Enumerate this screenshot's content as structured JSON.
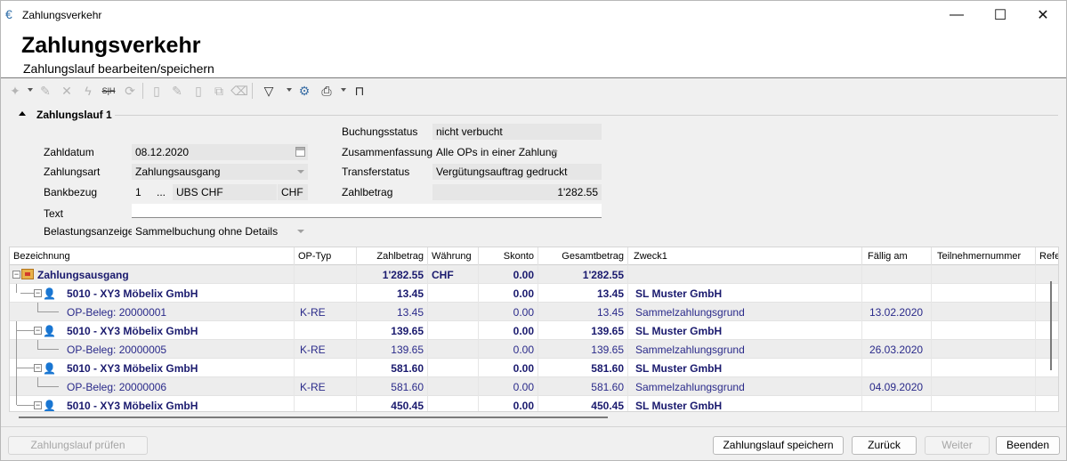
{
  "window": {
    "title": "Zahlungsverkehr",
    "minimize": "—",
    "maximize": "☐",
    "close": "✕"
  },
  "header": {
    "title": "Zahlungsverkehr",
    "subtitle": "Zahlungslauf bearbeiten/speichern"
  },
  "toolbar": {
    "icons": [
      "wand-icon",
      "pencil-icon",
      "delete-icon",
      "lightning-icon",
      "s-h-icon",
      "refresh-icon",
      "new-document-icon",
      "edit-document-icon",
      "delete-document-icon",
      "copy-document-icon",
      "eraser-icon",
      "filter-icon",
      "settings-icon",
      "print-icon",
      "export-icon"
    ]
  },
  "group": {
    "title": "Zahlungslauf 1"
  },
  "form": {
    "zahldatum": {
      "label": "Zahldatum",
      "value": "08.12.2020"
    },
    "zahlungsart": {
      "label": "Zahlungsart",
      "value": "Zahlungsausgang"
    },
    "bankbezug": {
      "label": "Bankbezug",
      "number": "1",
      "ellipsis": "...",
      "bank": "UBS CHF",
      "currency": "CHF"
    },
    "text": {
      "label": "Text",
      "value": ""
    },
    "belastungsanzeige": {
      "label": "Belastungsanzeige",
      "value": "Sammelbuchung ohne Details"
    },
    "buchungsstatus": {
      "label": "Buchungsstatus",
      "value": "nicht verbucht"
    },
    "zusammenfassung": {
      "label": "Zusammenfassung",
      "value": "Alle OPs in einer Zahlung"
    },
    "transferstatus": {
      "label": "Transferstatus",
      "value": "Vergütungsauftrag gedruckt"
    },
    "zahlbetrag": {
      "label": "Zahlbetrag",
      "value": "1'282.55"
    }
  },
  "grid": {
    "columns": [
      "Bezeichnung",
      "OP-Typ",
      "Zahlbetrag",
      "Währung",
      "Skonto",
      "Gesamtbetrag",
      "Zweck1",
      "Fällig am",
      "Teilnehmernummer",
      "Refe"
    ],
    "rows": [
      {
        "kind": "root",
        "bezeichnung": "Zahlungsausgang",
        "optyp": "",
        "zahlbetrag": "1'282.55",
        "waehrung": "CHF",
        "skonto": "0.00",
        "gesamt": "1'282.55",
        "zweck": "",
        "faellig": ""
      },
      {
        "kind": "group",
        "bezeichnung": "5010 - XY3 Möbelix GmbH",
        "optyp": "",
        "zahlbetrag": "13.45",
        "waehrung": "",
        "skonto": "0.00",
        "gesamt": "13.45",
        "zweck": "SL Muster GmbH",
        "faellig": ""
      },
      {
        "kind": "item",
        "bezeichnung": "OP-Beleg: 20000001",
        "optyp": "K-RE",
        "zahlbetrag": "13.45",
        "waehrung": "",
        "skonto": "0.00",
        "gesamt": "13.45",
        "zweck": "Sammelzahlungsgrund",
        "faellig": "13.02.2020"
      },
      {
        "kind": "group",
        "bezeichnung": "5010 - XY3 Möbelix GmbH",
        "optyp": "",
        "zahlbetrag": "139.65",
        "waehrung": "",
        "skonto": "0.00",
        "gesamt": "139.65",
        "zweck": "SL Muster GmbH",
        "faellig": ""
      },
      {
        "kind": "item",
        "bezeichnung": "OP-Beleg: 20000005",
        "optyp": "K-RE",
        "zahlbetrag": "139.65",
        "waehrung": "",
        "skonto": "0.00",
        "gesamt": "139.65",
        "zweck": "Sammelzahlungsgrund",
        "faellig": "26.03.2020"
      },
      {
        "kind": "group",
        "bezeichnung": "5010 - XY3 Möbelix GmbH",
        "optyp": "",
        "zahlbetrag": "581.60",
        "waehrung": "",
        "skonto": "0.00",
        "gesamt": "581.60",
        "zweck": "SL Muster GmbH",
        "faellig": ""
      },
      {
        "kind": "item",
        "bezeichnung": "OP-Beleg: 20000006",
        "optyp": "K-RE",
        "zahlbetrag": "581.60",
        "waehrung": "",
        "skonto": "0.00",
        "gesamt": "581.60",
        "zweck": "Sammelzahlungsgrund",
        "faellig": "04.09.2020"
      },
      {
        "kind": "group",
        "bezeichnung": "5010 - XY3 Möbelix GmbH",
        "optyp": "",
        "zahlbetrag": "450.45",
        "waehrung": "",
        "skonto": "0.00",
        "gesamt": "450.45",
        "zweck": "SL Muster GmbH",
        "faellig": ""
      }
    ]
  },
  "buttons": {
    "pruefen": "Zahlungslauf prüfen",
    "speichern": "Zahlungslauf speichern",
    "zurueck": "Zurück",
    "weiter": "Weiter",
    "beenden": "Beenden"
  }
}
